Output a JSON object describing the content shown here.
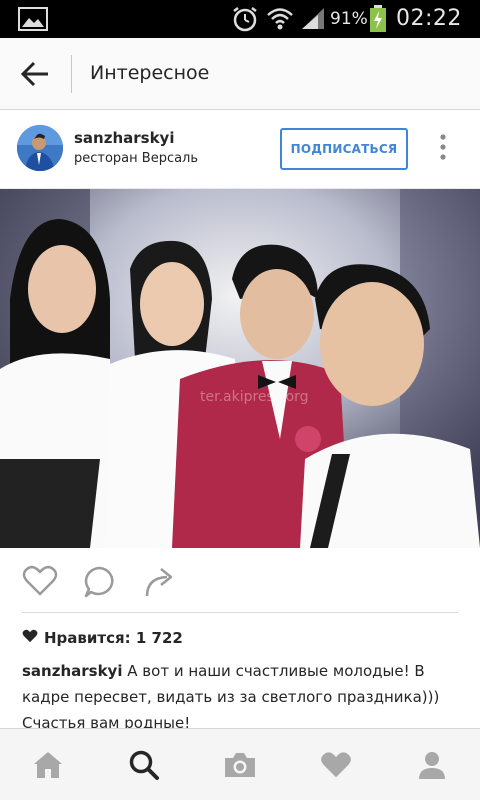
{
  "status_bar": {
    "battery_percent": "91%",
    "time": "02:22",
    "icons": [
      "gallery-icon",
      "alarm-icon",
      "wifi-icon",
      "signal-icon",
      "battery-icon"
    ]
  },
  "header": {
    "title": "Интересное",
    "back_icon": "back-arrow-icon"
  },
  "post": {
    "username": "sanzharskyi",
    "location": "ресторан Версаль",
    "follow_label": "ПОДПИСАТЬСЯ",
    "more_icon": "more-vertical-icon",
    "watermark": "ter.akipress.org",
    "likes_label": "Нравится: 1 722",
    "caption_user": "sanzharskyi",
    "caption_text": "А вот и наши счастливые молодые! В кадре пересвет, видать из за светлого праздника))) Счастья вам родные!"
  },
  "actions": [
    "like-heart-icon",
    "comment-icon",
    "share-icon"
  ],
  "nav": [
    "home-icon",
    "search-icon",
    "camera-icon",
    "activity-heart-icon",
    "profile-icon"
  ],
  "colors": {
    "accent": "#3f86d5",
    "text": "#262626",
    "icon_gray": "#a8a8a8"
  }
}
